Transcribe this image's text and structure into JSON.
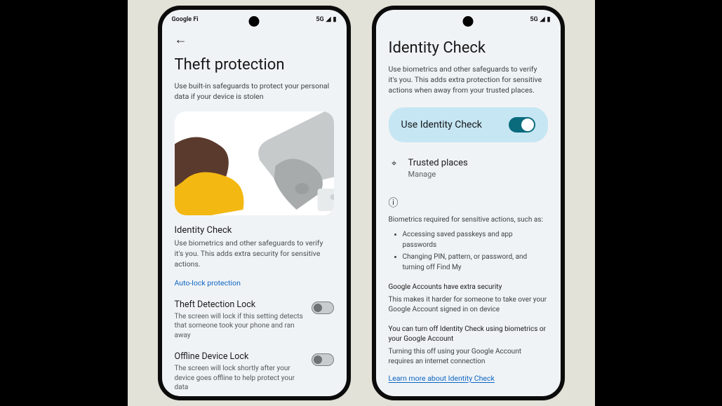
{
  "status": {
    "carrier": "Google Fi",
    "network": "5G"
  },
  "phone_left": {
    "title": "Theft protection",
    "subtitle": "Use built-in safeguards to protect your personal data if your device is stolen",
    "identity_check": {
      "label": "Identity Check",
      "desc": "Use biometrics and other safeguards to verify it's you. This adds extra security for sensitive actions."
    },
    "auto_lock_link": "Auto-lock protection",
    "theft_detection": {
      "label": "Theft Detection Lock",
      "desc": "The screen will lock if this setting detects that someone took your phone and ran away",
      "enabled": false
    },
    "offline_lock": {
      "label": "Offline Device Lock",
      "desc": "The screen will lock shortly after your device goes offline to help protect your data",
      "enabled": false
    }
  },
  "phone_right": {
    "title": "Identity Check",
    "subtitle": "Use biometrics and other safeguards to verify it's you. This adds extra protection for sensitive actions when away from your trusted places.",
    "toggle": {
      "label": "Use Identity Check",
      "enabled": true
    },
    "trusted": {
      "label": "Trusted places",
      "sub": "Manage"
    },
    "biometrics_head": "Biometrics required for sensitive actions, such as:",
    "bullets": [
      "Accessing saved passkeys and app passwords",
      "Changing PIN, pattern, or password, and turning off Find My"
    ],
    "extra_head": "Google Accounts have extra security",
    "extra_body": "This makes it harder for someone to take over your Google Account signed in on device",
    "turnoff_head": "You can turn off Identity Check using biometrics or your Google Account",
    "turnoff_body": "Turning this off using your Google Account requires an internet connection",
    "learn_more": "Learn more about Identity Check"
  }
}
